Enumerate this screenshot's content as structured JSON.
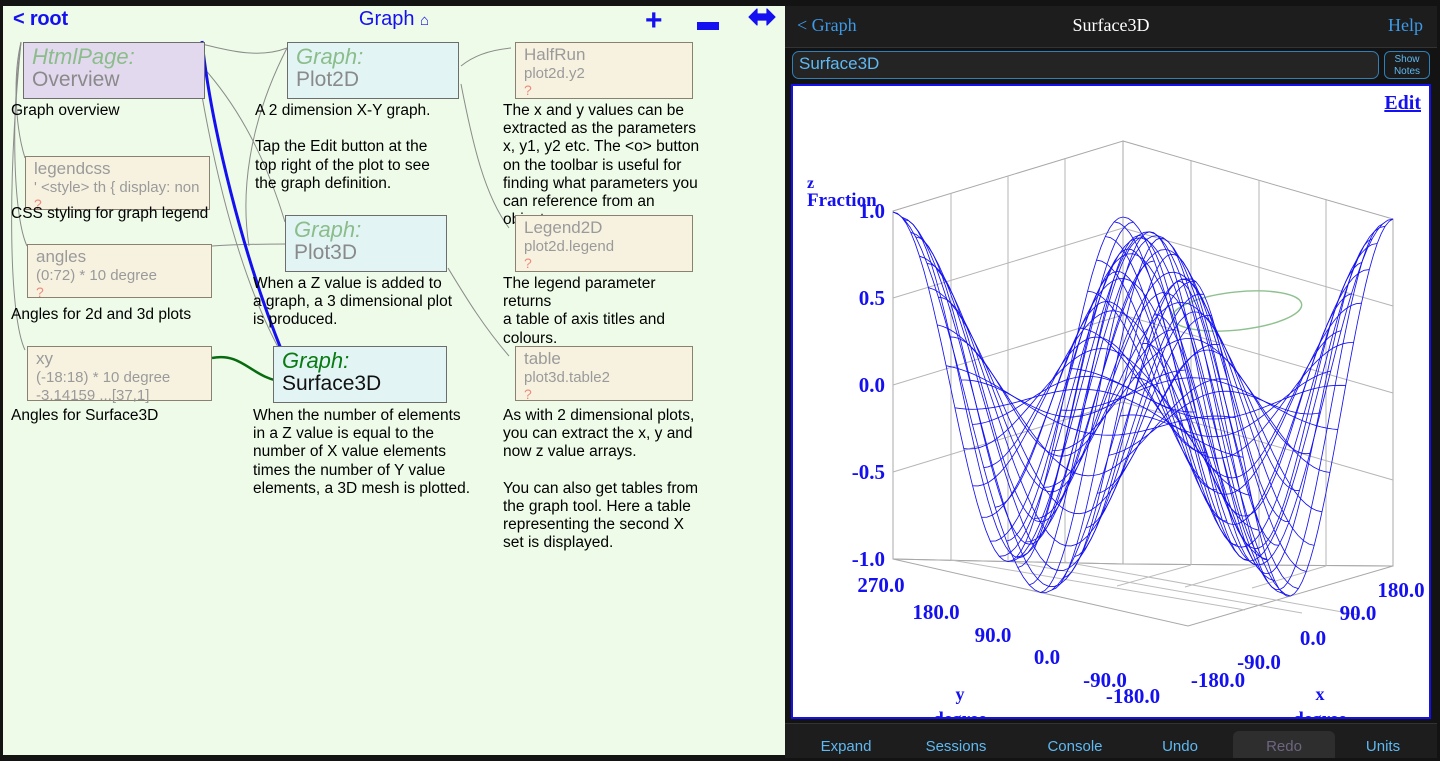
{
  "left_panel": {
    "toolbar": {
      "back_label": "< root",
      "title": "Graph",
      "home_icon": "⌂",
      "zoom_in_label": "+",
      "zoom_out_label": "–",
      "expand_label": "⬌"
    },
    "nodes": [
      {
        "id": "overview",
        "kind": "html",
        "type_label": "HtmlPage:",
        "name_label": "Overview",
        "note": "Graph overview",
        "selected": false
      },
      {
        "id": "legendcss",
        "kind": "var",
        "var_name": "legendcss",
        "var_value": "' <style> th { display: non",
        "var_flag": "?",
        "note": "CSS styling for graph legend",
        "selected": false
      },
      {
        "id": "angles",
        "kind": "var",
        "var_name": "angles",
        "var_value": "(0:72) * 10 degree",
        "var_flag": "?",
        "note": "Angles for 2d and 3d plots",
        "selected": false
      },
      {
        "id": "xy",
        "kind": "var",
        "var_name": "xy",
        "var_value": "(-18:18) * 10 degree",
        "var_value2": "-3.14159 ...[37,1]",
        "note": "Angles for Surface3D",
        "selected": false
      },
      {
        "id": "plot2d",
        "kind": "graph",
        "type_label": "Graph:",
        "name_label": "Plot2D",
        "note": "A 2 dimension X-Y graph.\n\nTap the Edit button at the\ntop right of the plot to see\nthe graph definition.",
        "selected": false
      },
      {
        "id": "plot3d",
        "kind": "graph",
        "type_label": "Graph:",
        "name_label": "Plot3D",
        "note": "When a Z value is added to\na graph, a 3 dimensional plot\nis produced.",
        "selected": false
      },
      {
        "id": "surface3d",
        "kind": "graph",
        "type_label": "Graph:",
        "name_label": "Surface3D",
        "note": "When the number of elements\nin a Z value is equal to the\nnumber of X value elements\ntimes the number of Y value\nelements, a 3D mesh is plotted.",
        "selected": true
      },
      {
        "id": "halfrun",
        "kind": "var",
        "var_name": "HalfRun",
        "var_value": "plot2d.y2",
        "var_flag": "?",
        "note": "The x and y values can be\nextracted as the parameters\nx, y1, y2 etc. The <o> button\non the toolbar is useful for\nfinding what parameters you\ncan reference from an object.",
        "selected": false
      },
      {
        "id": "legend2d",
        "kind": "var",
        "var_name": "Legend2D",
        "var_value": "plot2d.legend",
        "var_flag": "?",
        "note": "The legend parameter returns\na table of axis titles and\ncolours.",
        "selected": false
      },
      {
        "id": "table",
        "kind": "var",
        "var_name": "table",
        "var_value": "plot3d.table2",
        "var_flag": "?",
        "note": "As with 2 dimensional plots,\nyou can extract the x, y and\nnow z value arrays.\n\nYou can also get tables from\nthe graph tool. Here a table\nrepresenting the second X\nset is displayed.",
        "selected": false
      }
    ],
    "colors": {
      "background": "#eefbe8",
      "accent": "#1410f0",
      "selected_edge": "#0a6b12",
      "highlight_edge": "#1410f0"
    }
  },
  "right_panel": {
    "header": {
      "back_label": "< Graph",
      "title": "Surface3D",
      "help_label": "Help"
    },
    "pathbar": {
      "value": "Surface3D",
      "show_notes_line1": "Show",
      "show_notes_line2": "Notes"
    },
    "plot": {
      "edit_label": "Edit"
    },
    "footer": {
      "buttons": [
        {
          "label": "Expand",
          "disabled": false
        },
        {
          "label": "Sessions",
          "disabled": false
        },
        {
          "label": "Console",
          "disabled": false
        },
        {
          "label": "Undo",
          "disabled": false
        },
        {
          "label": "Redo",
          "disabled": true
        },
        {
          "label": "Units",
          "disabled": false
        }
      ]
    }
  },
  "chart_data": {
    "type": "surface",
    "title": "Surface3D",
    "zlabel": "z",
    "zunits": "Fraction",
    "xlabel": "x",
    "xunits": "degree",
    "ylabel": "y",
    "yunits": "degree",
    "z_ticks": [
      "1.0",
      "0.5",
      "0.0",
      "-0.5",
      "-1.0"
    ],
    "z_values": [
      1.0,
      0.5,
      0.0,
      -0.5,
      -1.0
    ],
    "zlim": [
      -1.0,
      1.0
    ],
    "y_ticks": [
      "270.0",
      "180.0",
      "90.0",
      "0.0",
      "-90.0",
      "-180.0"
    ],
    "y_values": [
      270.0,
      180.0,
      90.0,
      0.0,
      -90.0,
      -180.0
    ],
    "ylim": [
      -180.0,
      270.0
    ],
    "x_ticks": [
      "-180.0",
      "-90.0",
      "0.0",
      "90.0",
      "180.0"
    ],
    "x_values": [
      -180.0,
      -90.0,
      0.0,
      90.0,
      180.0
    ],
    "xlim": [
      -180.0,
      180.0
    ],
    "mesh_color": "#1410f0",
    "grid_color": "#a8a8a8",
    "annotation_color": "#8fc08f",
    "surface_formula": "z = cos(x) * cos(y)",
    "grid_steps_x": 37,
    "grid_steps_y": 37,
    "grid": true,
    "legend": "none"
  }
}
